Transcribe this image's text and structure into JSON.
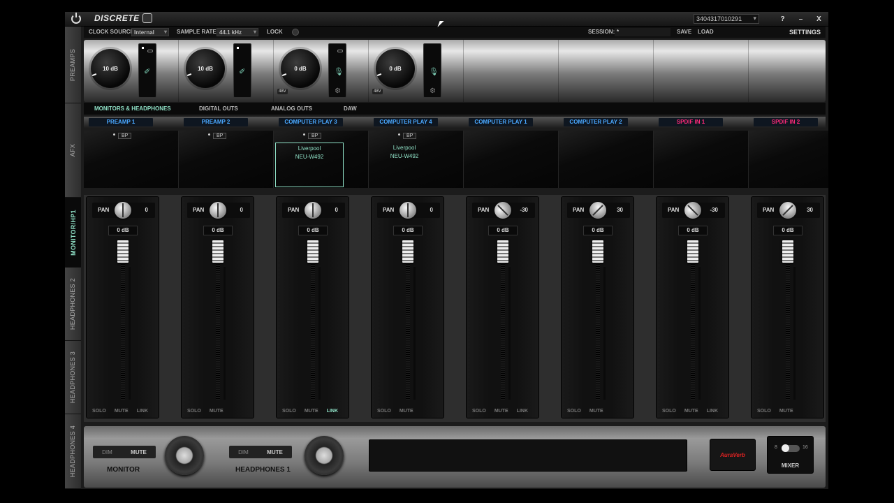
{
  "topbar": {
    "title": "DISCRETE",
    "serial": "3404317010291",
    "help": "?",
    "minimize": "–",
    "close": "X"
  },
  "sidetabs": [
    "PREAMPS",
    "AFX",
    "MONITOR/HP1",
    "HEADPHONES 2",
    "HEADPHONES 3",
    "HEADPHONES 4"
  ],
  "config": {
    "clock_source_label": "CLOCK SOURCE",
    "clock_source_value": "Internal",
    "sample_rate_label": "SAMPLE RATE",
    "sample_rate_value": "44.1 kHz",
    "lock_label": "LOCK",
    "session_label": "SESSION:",
    "session_value": "*",
    "save": "SAVE",
    "load": "LOAD",
    "settings": "SETTINGS"
  },
  "preamps": [
    {
      "gain": "10 dB",
      "v48": "",
      "icon": "guitar"
    },
    {
      "gain": "10 dB",
      "v48": "",
      "icon": "guitar"
    },
    {
      "gain": "0 dB",
      "v48": "48V",
      "icon": "mic"
    },
    {
      "gain": "0 dB",
      "v48": "48V",
      "icon": "mic"
    }
  ],
  "routing": {
    "monitors": "MONITORS & HEADPHONES",
    "digital": "DIGITAL OUTS",
    "analog": "ANALOG OUTS",
    "daw": "DAW"
  },
  "channels": [
    "PREAMP 1",
    "PREAMP 2",
    "COMPUTER PLAY 3",
    "COMPUTER PLAY 4",
    "COMPUTER PLAY 1",
    "COMPUTER PLAY 2",
    "SPDIF IN 1",
    "SPDIF IN 2"
  ],
  "channel_colors": [
    "#4aa8ff",
    "#4aa8ff",
    "#4aa8ff",
    "#4aa8ff",
    "#4aa8ff",
    "#4aa8ff",
    "#ff2a7a",
    "#ff2a7a"
  ],
  "afx": [
    {
      "bp": "BP",
      "plugin1": "",
      "plugin2": ""
    },
    {
      "bp": "BP",
      "plugin1": "",
      "plugin2": ""
    },
    {
      "bp": "BP",
      "plugin1": "Liverpool",
      "plugin2": "NEU-W492"
    },
    {
      "bp": "BP",
      "plugin1": "Liverpool",
      "plugin2": "NEU-W492"
    }
  ],
  "strips": [
    {
      "pan_label": "PAN",
      "pan": "0",
      "gain": "0 dB",
      "solo": "SOLO",
      "mute": "MUTE",
      "link": "LINK"
    },
    {
      "pan_label": "PAN",
      "pan": "0",
      "gain": "0 dB",
      "solo": "SOLO",
      "mute": "MUTE",
      "link": ""
    },
    {
      "pan_label": "PAN",
      "pan": "0",
      "gain": "0 dB",
      "solo": "SOLO",
      "mute": "MUTE",
      "link": "LINK"
    },
    {
      "pan_label": "PAN",
      "pan": "0",
      "gain": "0 dB",
      "solo": "SOLO",
      "mute": "MUTE",
      "link": ""
    },
    {
      "pan_label": "PAN",
      "pan": "-30",
      "gain": "0 dB",
      "solo": "SOLO",
      "mute": "MUTE",
      "link": "LINK"
    },
    {
      "pan_label": "PAN",
      "pan": "30",
      "gain": "0 dB",
      "solo": "SOLO",
      "mute": "MUTE",
      "link": ""
    },
    {
      "pan_label": "PAN",
      "pan": "-30",
      "gain": "0 dB",
      "solo": "SOLO",
      "mute": "MUTE",
      "link": "LINK"
    },
    {
      "pan_label": "PAN",
      "pan": "30",
      "gain": "0 dB",
      "solo": "SOLO",
      "mute": "MUTE",
      "link": ""
    }
  ],
  "footer": {
    "dim": "DIM",
    "mute": "MUTE",
    "monitor_label": "MONITOR",
    "headphones_label": "HEADPHONES 1",
    "auraverb": "AuraVerb",
    "mixer_label": "MIXER",
    "mixer_8": "8",
    "mixer_16": "16"
  }
}
